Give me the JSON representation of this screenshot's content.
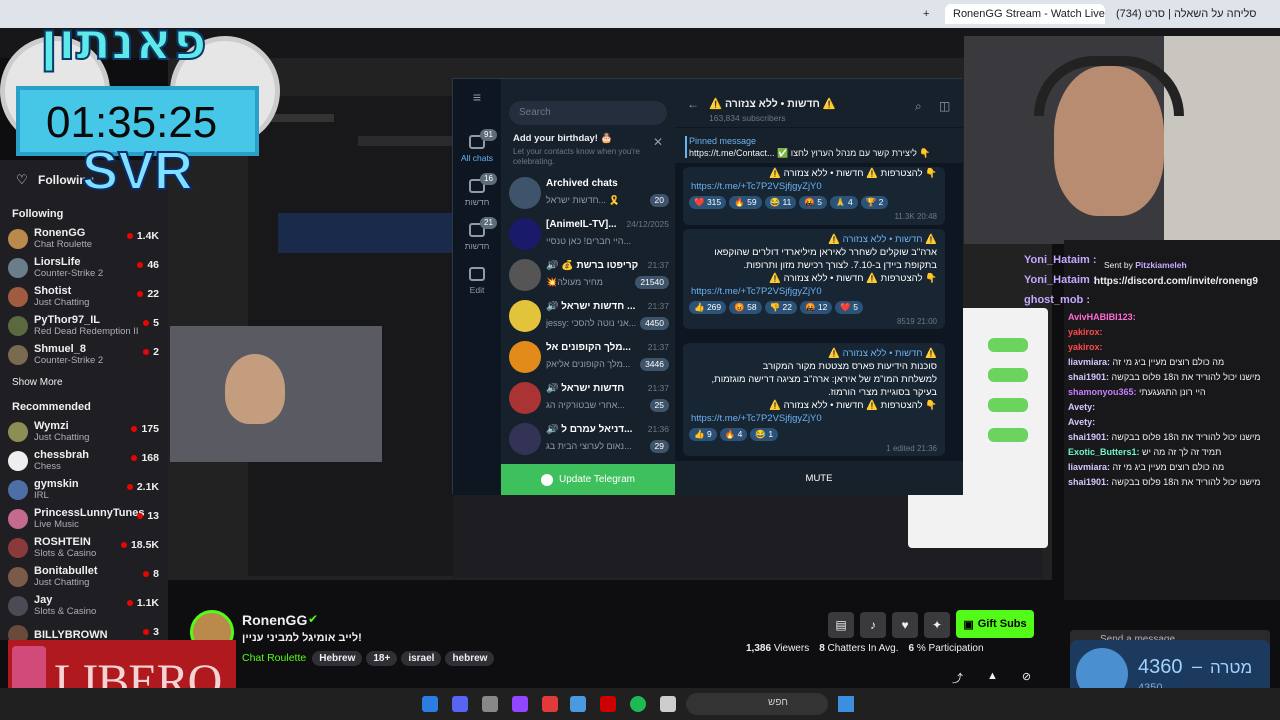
{
  "browser": {
    "tab1": "RonenGG Stream - Watch Live",
    "tab2": "(734) סליחה על השאלה | סרט",
    "new_tab": "+"
  },
  "overlay": {
    "logo_text": "פאנתון",
    "timer": "01:35:25",
    "sub": "SVR",
    "sponsor": "LIBERO"
  },
  "twitch": {
    "following_label": "Following",
    "following_header": "Following",
    "show_more": "Show More",
    "recommended": "Recommended",
    "following": [
      {
        "name": "RonenGG",
        "game": "Chat Roulette",
        "viewers": "1.4K",
        "color": "#b98a4c"
      },
      {
        "name": "LiorsLife",
        "game": "Counter-Strike 2",
        "viewers": "46",
        "color": "#6b7d8a"
      },
      {
        "name": "Shotist",
        "game": "Just Chatting",
        "viewers": "22",
        "color": "#a15c3f"
      },
      {
        "name": "PyThor97_IL",
        "game": "Red Dead Redemption II",
        "viewers": "5",
        "color": "#5b6a3e"
      },
      {
        "name": "Shmuel_8",
        "game": "Counter-Strike 2",
        "viewers": "2",
        "color": "#7a6a4f"
      }
    ],
    "recommended_list": [
      {
        "name": "Wymzi",
        "game": "Just Chatting",
        "viewers": "175",
        "color": "#8c8f55"
      },
      {
        "name": "chessbrah",
        "game": "Chess",
        "viewers": "168",
        "color": "#eee"
      },
      {
        "name": "gymskin",
        "game": "IRL",
        "viewers": "2.1K",
        "color": "#4d6fa5"
      },
      {
        "name": "PrincessLunnyTunes",
        "game": "Live Music",
        "viewers": "13",
        "color": "#c46b8d"
      },
      {
        "name": "ROSHTEIN",
        "game": "Slots & Casino",
        "viewers": "18.5K",
        "color": "#8a3a3a"
      },
      {
        "name": "Bonitabullet",
        "game": "Just Chatting",
        "viewers": "8",
        "color": "#7a5b4a"
      },
      {
        "name": "Jay",
        "game": "Slots & Casino",
        "viewers": "1.1K",
        "color": "#4b4b55"
      },
      {
        "name": "BILLYBROWN",
        "game": "",
        "viewers": "3",
        "color": "#6a4a3a"
      }
    ],
    "streamer": "RonenGG",
    "stream_title": "לייב אומיגל למביני עניין!",
    "category": "Chat Roulette",
    "tags": [
      "Hebrew",
      "18+",
      "israel",
      "hebrew"
    ],
    "viewers": "1,386",
    "viewers_label": "Viewers",
    "chatters": "8",
    "chatters_label": "Chatters In Avg.",
    "participation": "6",
    "participation_label": "% Participation",
    "gift_subs": "Gift Subs",
    "send_message": "Send a message",
    "goal_value": "4360",
    "goal_label": "מטרה",
    "goal_sub": "4350",
    "goal_dash": "–"
  },
  "telegram": {
    "search": "Search",
    "folders": [
      {
        "label": "All chats",
        "badge": "91"
      },
      {
        "label": "חדשות",
        "badge": "16"
      },
      {
        "label": "חדשות",
        "badge": "21"
      },
      {
        "label": "Edit",
        "badge": ""
      }
    ],
    "birthday_title": "Add your birthday! 🎂",
    "birthday_sub": "Let your contacts know when you're celebrating.",
    "chats": [
      {
        "name": "Archived chats",
        "time": "",
        "preview": "חדשות ישראל... 🎗️",
        "badge": "20",
        "color": "#3e546a"
      },
      {
        "name": "[AnimeIL-TV]...",
        "time": "24/12/2025",
        "preview": "היי חברים! כאן טנסיי...",
        "badge": "",
        "color": "#1a1a6a"
      },
      {
        "name": "🔊 💰 קריפטו ברשת 💰",
        "time": "21:37",
        "preview": "💥מחיר מעולה",
        "badge": "21540",
        "color": "#555"
      },
      {
        "name": "🔊 חדשות ישראל ...",
        "time": "21:37",
        "preview": "jessy: אני נוטה להסכי...",
        "badge": "4450",
        "color": "#e3c33a"
      },
      {
        "name": "מלך הקופונים אל...",
        "time": "21:37",
        "preview": "מלך הקופונים אליאק...",
        "badge": "3446",
        "color": "#e38b1a"
      },
      {
        "name": "🔊 חדשות ישראל",
        "time": "21:37",
        "preview": "אחרי שבטורקיה הג...",
        "badge": "25",
        "color": "#a33"
      },
      {
        "name": "🔊 דניאל עמרם ל...",
        "time": "21:36",
        "preview": "נאום לערוצי הבית בג...",
        "badge": "29",
        "color": "#335"
      }
    ],
    "update_btn": "Update Telegram",
    "channel_title": "⚠️ חדשות • ללא צנזורה ⚠️",
    "subscribers": "163,834 subscribers",
    "pinned_label": "Pinned message",
    "pinned_text": "https://t.me/Contact... ✅ ליצירת קשר עם מנהל הערוץ לחצו 👇",
    "link": "https://t.me/+Tc7P2VSjfjgyZjY0",
    "messages": [
      {
        "header": "⚠️ חדשות • ללא צנזורה ⚠️",
        "lines": [
          "ארה\"ב שוקלים לשחרר לאיראן מיליארדי דולרים שהוקפאו",
          "בתקופת ביידן ב-7.10. לצורך רכישת מזון ותרופות."
        ],
        "footer": "👇 להצטרפות ⚠️ חדשות • ללא צנזורה ⚠️",
        "reacts": [
          "👍 269",
          "😡 58",
          "👎 22",
          "🤬 12",
          "❤️ 5"
        ],
        "meta": "8519 21:00"
      },
      {
        "header": "⚠️ חדשות • ללא צנזורה ⚠️",
        "lines": [
          "סוכנות הידיעות פארס מצטטת מקור המקורב",
          "למשלחת המו\"מ של איראן: ארה\"ב מציגה דרישה מוגזמות,",
          "בעיקר בסוגיית מצרי הורמוז."
        ],
        "footer": "👇 להצטרפות ⚠️ חדשות • ללא צנזורה ⚠️",
        "reacts": [
          "👍 9",
          "🔥 4",
          "😂 1"
        ],
        "meta": "1 edited 21:36"
      }
    ],
    "top_footer": "👇 להצטרפות ⚠️ חדשות • ללא צנזורה ⚠️",
    "top_reacts": [
      "❤️ 315",
      "🔥 59",
      "😂 11",
      "🤬 5",
      "🙏 4",
      "🏆 2"
    ],
    "top_meta": "11.3K 20:48",
    "mute": "MUTE"
  },
  "chat": {
    "sent_by": "Sent by",
    "sent_user": "Pitzkiameleh",
    "discord": "https://discord.com/invite/roneng9",
    "pinned_users": [
      "Yoni_Hataim :",
      "Yoni_Hataim :",
      "ghost_mob :"
    ],
    "lines": [
      {
        "user": "AvivHABIBI123:",
        "text": "",
        "color": "#ff6bd6"
      },
      {
        "user": "yakirox:",
        "text": "",
        "color": "#ff4a4a"
      },
      {
        "user": "yakirox:",
        "text": "",
        "color": "#ff4a4a"
      },
      {
        "user": "liavmiara:",
        "text": "מה כולם רוצים מעיין ביג מי זה",
        "color": "#d8c7ff"
      },
      {
        "user": "shai1901:",
        "text": "מישנו יכול להוריד את ה18 פלוס בבקשה",
        "color": "#d8c7ff"
      },
      {
        "user": "shamonyou365:",
        "text": "היי רונן התגעגעתי",
        "color": "#c77dff"
      },
      {
        "user": "Avety:",
        "text": "",
        "color": "#d8c7ff"
      },
      {
        "user": "Avety:",
        "text": "",
        "color": "#d8c7ff"
      },
      {
        "user": "shai1901:",
        "text": "מישנו יכול להוריד את ה18 פלוס בבקשה",
        "color": "#d8c7ff"
      },
      {
        "user": "Exotic_Butters1:",
        "text": "תמיד זה לך זה מה יש",
        "color": "#6ef7c7"
      },
      {
        "user": "liavmiara:",
        "text": "מה כולם רוצים מעיין ביג מי זה",
        "color": "#d8c7ff"
      },
      {
        "user": "shai1901:",
        "text": "מישנו יכול להוריד את ה18 פלוס בבקשה",
        "color": "#d8c7ff"
      }
    ]
  },
  "taskbar": {
    "search": "חפש"
  }
}
